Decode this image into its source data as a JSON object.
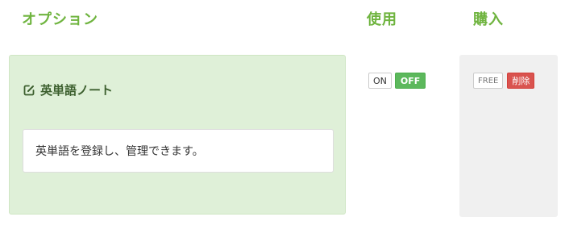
{
  "headers": {
    "option": "オプション",
    "use": "使用",
    "buy": "購入"
  },
  "option": {
    "icon": "edit-icon",
    "title": "英単語ノート",
    "description": "英単語を登録し、管理できます。"
  },
  "use": {
    "on_label": "ON",
    "off_label": "OFF",
    "active": "OFF"
  },
  "buy": {
    "free_label": "FREE",
    "delete_label": "削除"
  },
  "colors": {
    "header": "#6fb43f",
    "option_bg": "#dff0d8",
    "off_active": "#5cb85c",
    "delete": "#d9534f",
    "buy_panel_bg": "#f0f0f0"
  }
}
